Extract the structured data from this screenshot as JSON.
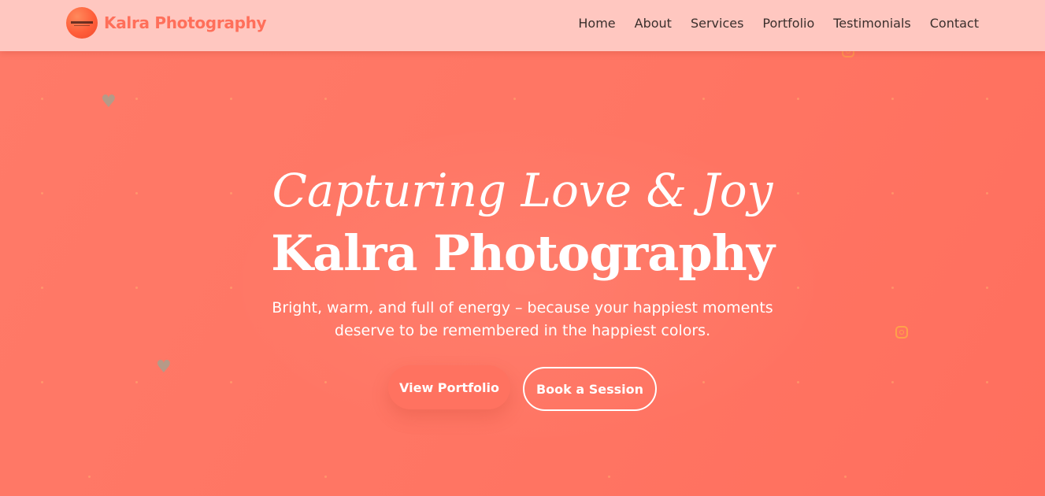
{
  "brand": {
    "name": "Kalra Photography",
    "logo_icon": "camera-logo-icon"
  },
  "nav": {
    "items": [
      {
        "label": "Home"
      },
      {
        "label": "About"
      },
      {
        "label": "Services"
      },
      {
        "label": "Portfolio"
      },
      {
        "label": "Testimonials"
      },
      {
        "label": "Contact"
      }
    ]
  },
  "hero": {
    "script_title": "Capturing Love & Joy",
    "title": "Kalra Photography",
    "subtitle": "Bright, warm, and full of energy – because your happiest moments deserve to be remembered in the happiest colors.",
    "primary_button": "View Portfolio",
    "secondary_button": "Book a Session"
  },
  "colors": {
    "hero_background": "#ff7866",
    "navbar_background": "#ffc7c0",
    "brand_text": "#ff6f5a",
    "nav_text": "#3a2f2c",
    "hero_text": "#ffffff"
  },
  "decorations": {
    "icons": [
      "heart-icon",
      "heart-icon",
      "instagram-icon",
      "instagram-icon"
    ]
  }
}
